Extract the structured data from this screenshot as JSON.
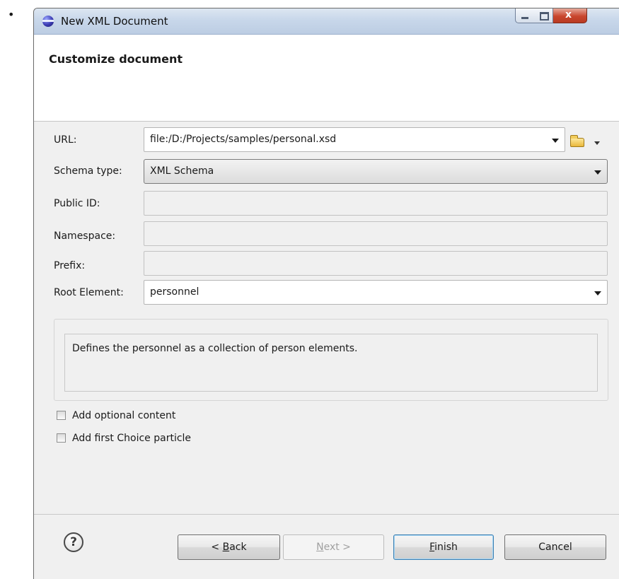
{
  "bullet": "•",
  "window": {
    "title": "New XML Document",
    "controls": {
      "minimize": "minimize",
      "maximize": "maximize",
      "close": "x"
    }
  },
  "header": {
    "title": "Customize document"
  },
  "form": {
    "url": {
      "label": "URL:",
      "value": "file:/D:/Projects/samples/personal.xsd"
    },
    "schema_type": {
      "label": "Schema type:",
      "value": "XML Schema"
    },
    "public_id": {
      "label": "Public ID:",
      "value": ""
    },
    "namespace": {
      "label": "Namespace:",
      "value": ""
    },
    "prefix": {
      "label": "Prefix:",
      "value": ""
    },
    "root_element": {
      "label": "Root Element:",
      "value": "personnel"
    }
  },
  "description": "Defines the personnel as a collection of person elements.",
  "options": [
    {
      "label": "Add optional content",
      "checked": false
    },
    {
      "label": "Add first Choice particle",
      "checked": false
    }
  ],
  "buttons": {
    "help": "?",
    "back": {
      "prefix": "< ",
      "mnemonic": "B",
      "rest": "ack"
    },
    "next": {
      "mnemonic": "N",
      "rest": "ext >"
    },
    "finish": {
      "mnemonic": "F",
      "rest": "inish"
    },
    "cancel": "Cancel"
  },
  "icons": {
    "app": "eclipse-icon",
    "browse": "folder-open-icon",
    "dropdown": "chevron-down-icon",
    "help": "help-icon"
  }
}
